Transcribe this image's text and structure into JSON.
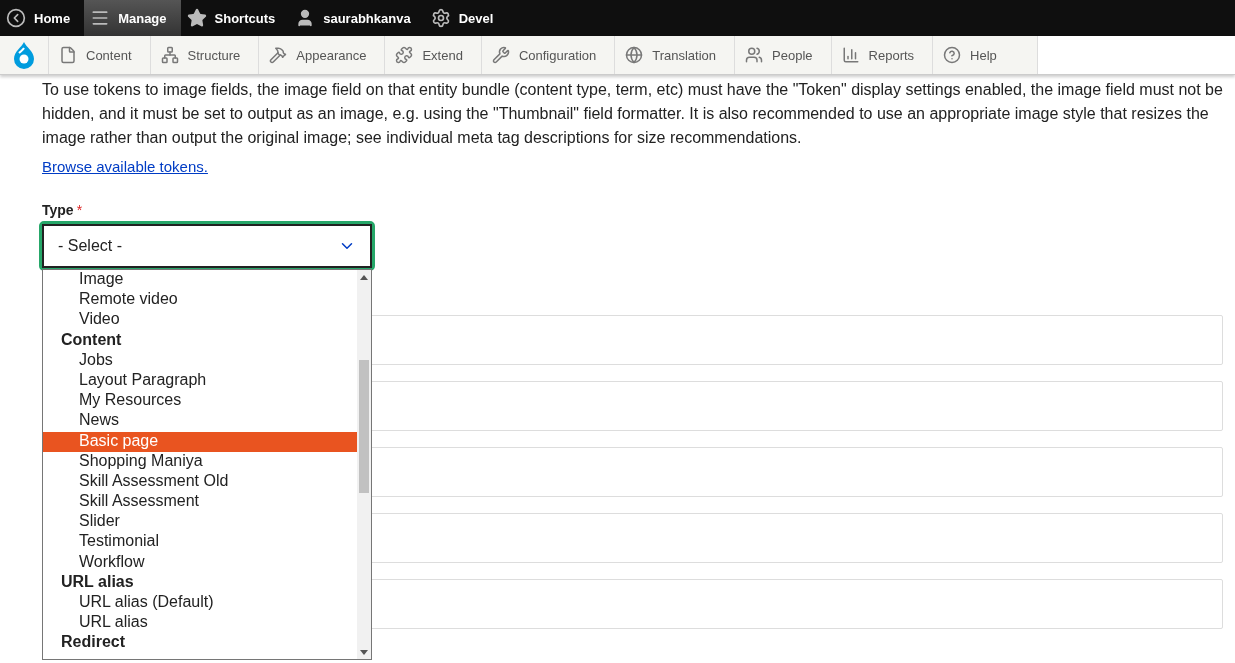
{
  "admin_bar": [
    {
      "label": "Home",
      "selected": false
    },
    {
      "label": "Manage",
      "selected": true
    },
    {
      "label": "Shortcuts",
      "selected": false
    },
    {
      "label": "saurabhkanva",
      "selected": false
    },
    {
      "label": "Devel",
      "selected": false
    }
  ],
  "toolbar": [
    {
      "label": "Content"
    },
    {
      "label": "Structure"
    },
    {
      "label": "Appearance"
    },
    {
      "label": "Extend"
    },
    {
      "label": "Configuration"
    },
    {
      "label": "Translation"
    },
    {
      "label": "People"
    },
    {
      "label": "Reports"
    },
    {
      "label": "Help"
    }
  ],
  "description": "To use tokens to image fields, the image field on that entity bundle (content type, term, etc) must have the \"Token\" display settings enabled, the image field must not be hidden, and it must be set to output as an image, e.g. using the \"Thumbnail\" field formatter. It is also recommended to use an appropriate image style that resizes the image rather than output the original image; see individual meta tag descriptions for size recommendations.",
  "browse_link": "Browse available tokens.",
  "type_field": {
    "label": "Type",
    "required_mark": "*",
    "value": "- Select -",
    "focused": true
  },
  "dropdown": [
    {
      "kind": "option",
      "label": "Image",
      "selected": false
    },
    {
      "kind": "option",
      "label": "Remote video",
      "selected": false
    },
    {
      "kind": "option",
      "label": "Video",
      "selected": false
    },
    {
      "kind": "group",
      "label": "Content",
      "children": [
        {
          "kind": "option",
          "label": "Jobs",
          "selected": false
        },
        {
          "kind": "option",
          "label": "Layout Paragraph",
          "selected": false
        },
        {
          "kind": "option",
          "label": "My Resources",
          "selected": false
        },
        {
          "kind": "option",
          "label": "News",
          "selected": false
        },
        {
          "kind": "option",
          "label": "Basic page",
          "selected": true
        },
        {
          "kind": "option",
          "label": "Shopping Maniya",
          "selected": false
        },
        {
          "kind": "option",
          "label": "Skill Assessment Old",
          "selected": false
        },
        {
          "kind": "option",
          "label": "Skill Assessment",
          "selected": false
        },
        {
          "kind": "option",
          "label": "Slider",
          "selected": false
        },
        {
          "kind": "option",
          "label": "Testimonial",
          "selected": false
        },
        {
          "kind": "option",
          "label": "Workflow",
          "selected": false
        }
      ]
    },
    {
      "kind": "group",
      "label": "URL alias",
      "children": [
        {
          "kind": "option",
          "label": "URL alias (Default)",
          "selected": false
        },
        {
          "kind": "option",
          "label": "URL alias",
          "selected": false
        }
      ]
    },
    {
      "kind": "group",
      "label": "Redirect"
    }
  ],
  "panels": [
    {
      "kind": "collapsed"
    },
    {
      "kind": "collapsed"
    },
    {
      "kind": "collapsed"
    },
    {
      "kind": "collapsed"
    },
    {
      "kind": "collapsed"
    }
  ]
}
